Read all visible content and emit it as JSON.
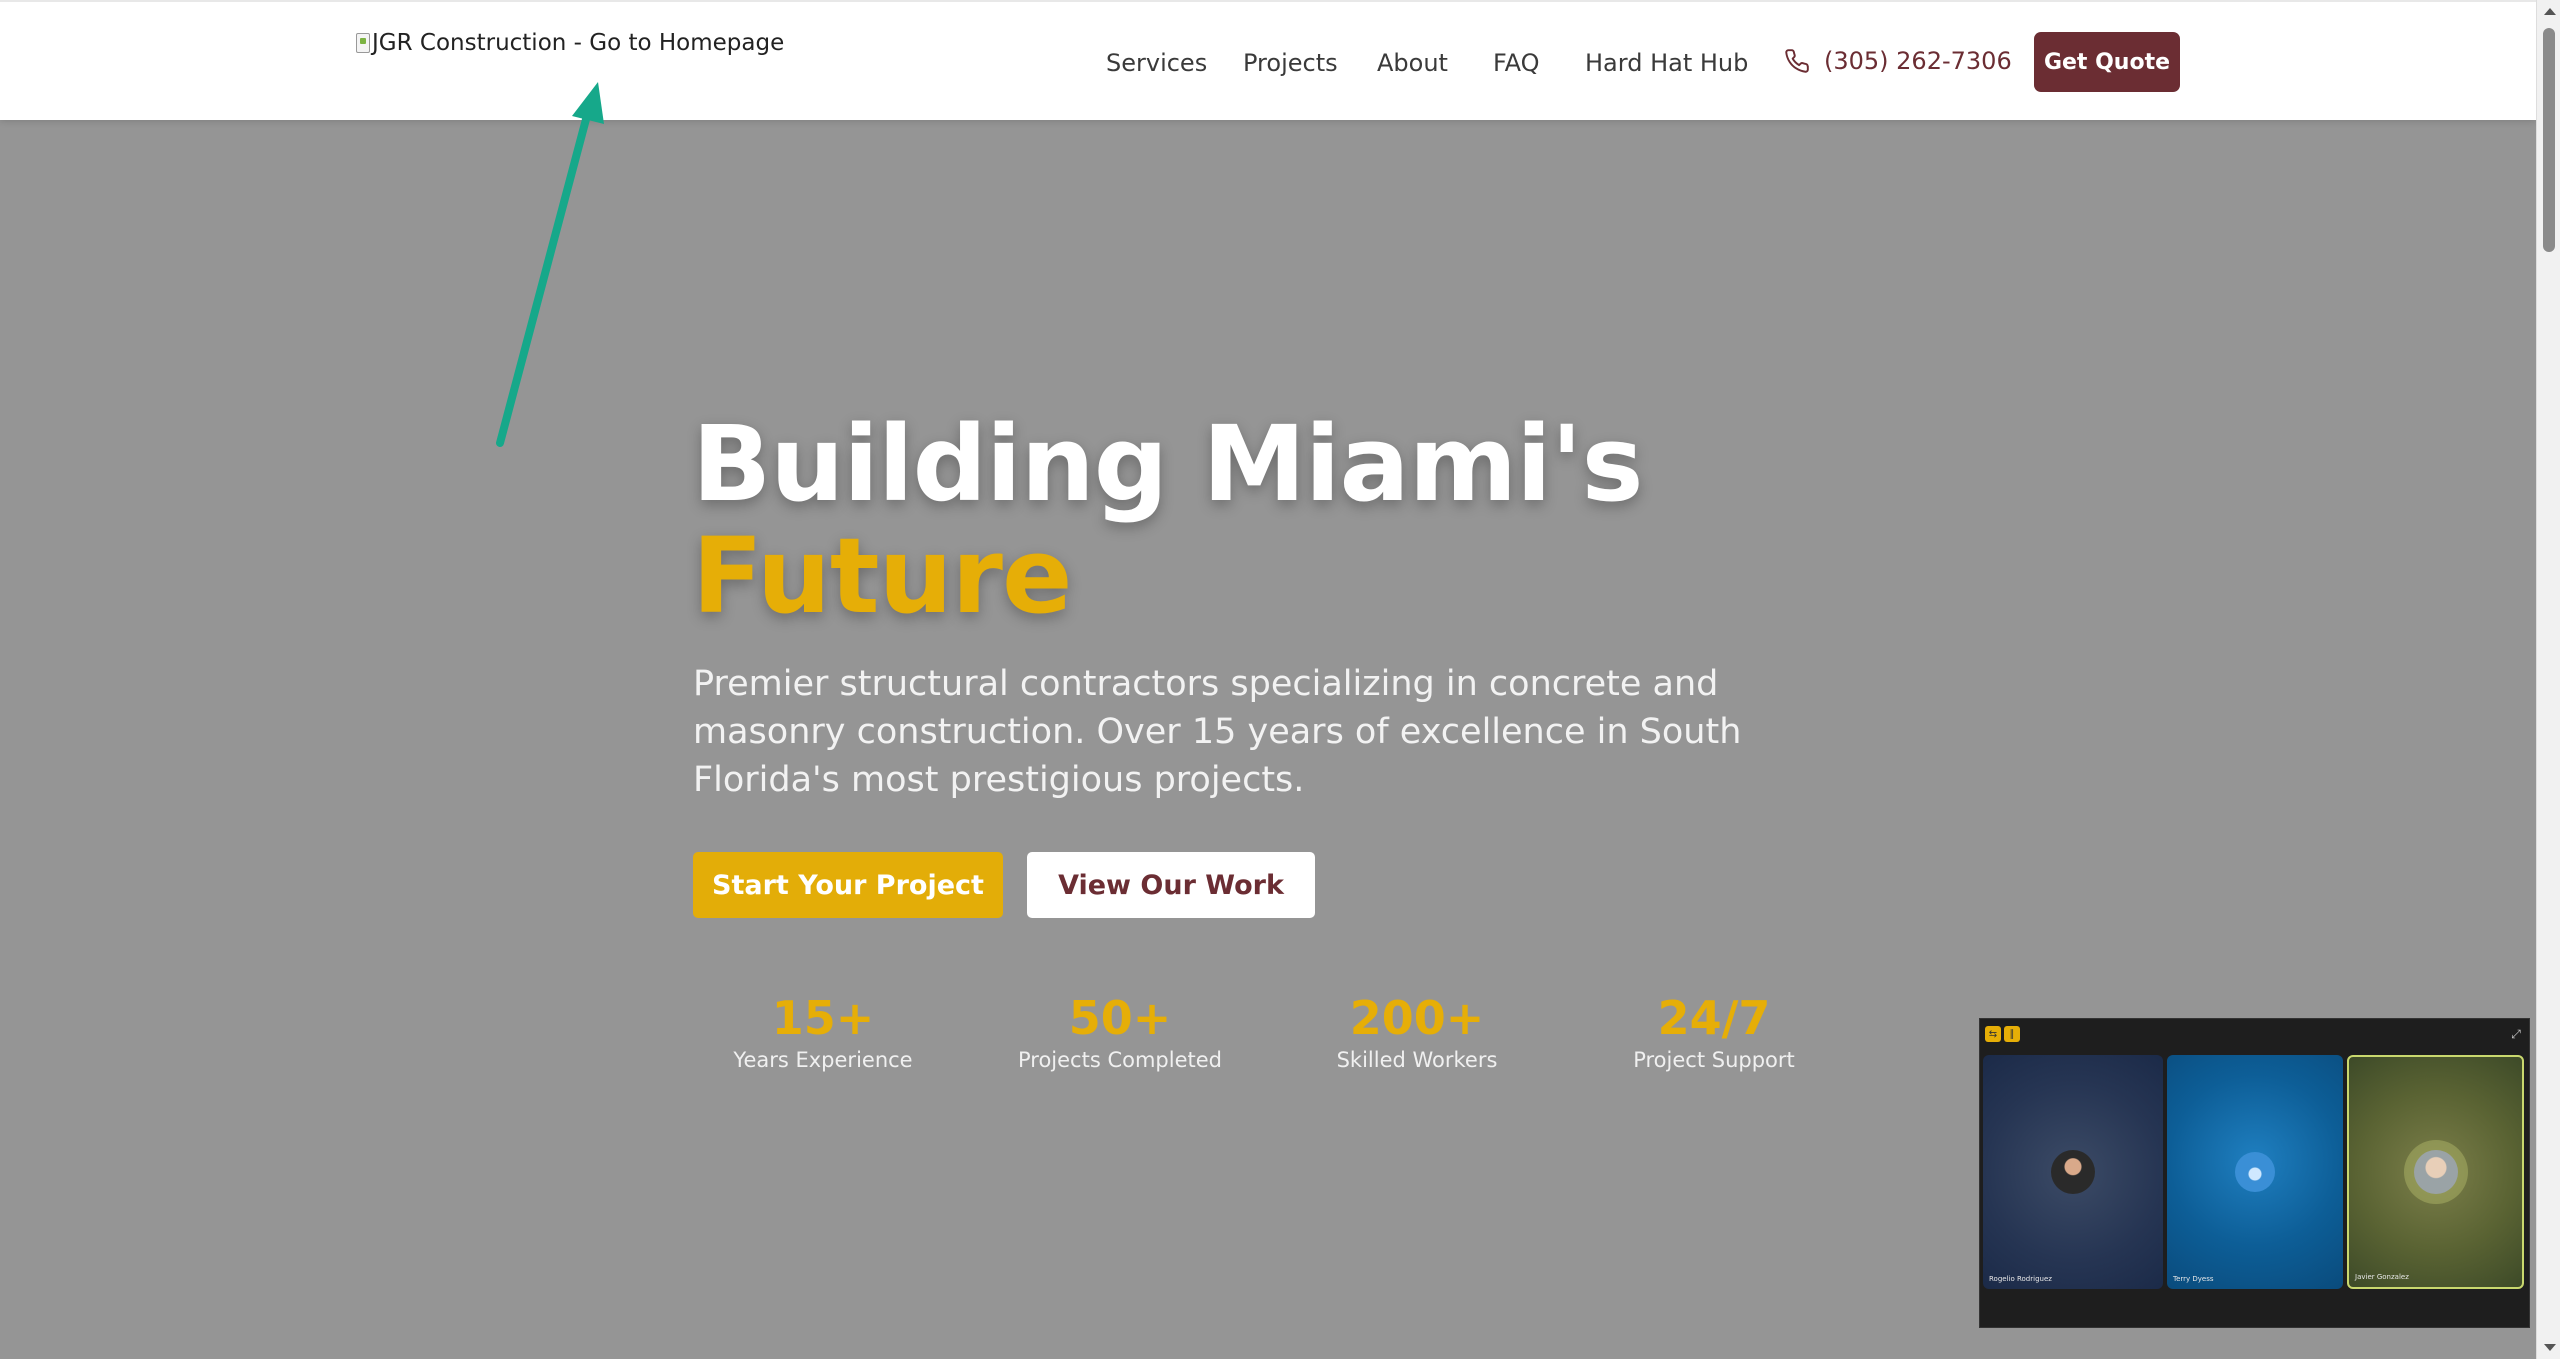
{
  "header": {
    "logo_alt": "JGR Construction - Go to Homepage",
    "nav": [
      {
        "label": "Services"
      },
      {
        "label": "Projects"
      },
      {
        "label": "About"
      },
      {
        "label": "FAQ"
      },
      {
        "label": "Hard Hat Hub"
      }
    ],
    "phone": "(305) 262-7306",
    "phone_icon": "phone-icon",
    "quote_label": "Get Quote"
  },
  "hero": {
    "title_line1": "Building Miami's",
    "title_accent": "Future",
    "subtitle": "Premier structural contractors specializing in concrete and masonry construction. Over 15 years of excellence in South Florida's most prestigious projects.",
    "primary_cta": "Start Your Project",
    "secondary_cta": "View Our Work"
  },
  "stats": [
    {
      "value": "15+",
      "label": "Years Experience"
    },
    {
      "value": "50+",
      "label": "Projects Completed"
    },
    {
      "value": "200+",
      "label": "Skilled Workers"
    },
    {
      "value": "24/7",
      "label": "Project Support"
    }
  ],
  "video_call": {
    "participants": [
      {
        "name": "Rogelio Rodriguez"
      },
      {
        "name": "Terry Dyess"
      },
      {
        "name": "Javier Gonzalez"
      }
    ]
  },
  "colors": {
    "brand": "#6b2d33",
    "accent": "#e6ae07",
    "hero_bg": "#959595",
    "annotation_arrow": "#16a88a"
  }
}
